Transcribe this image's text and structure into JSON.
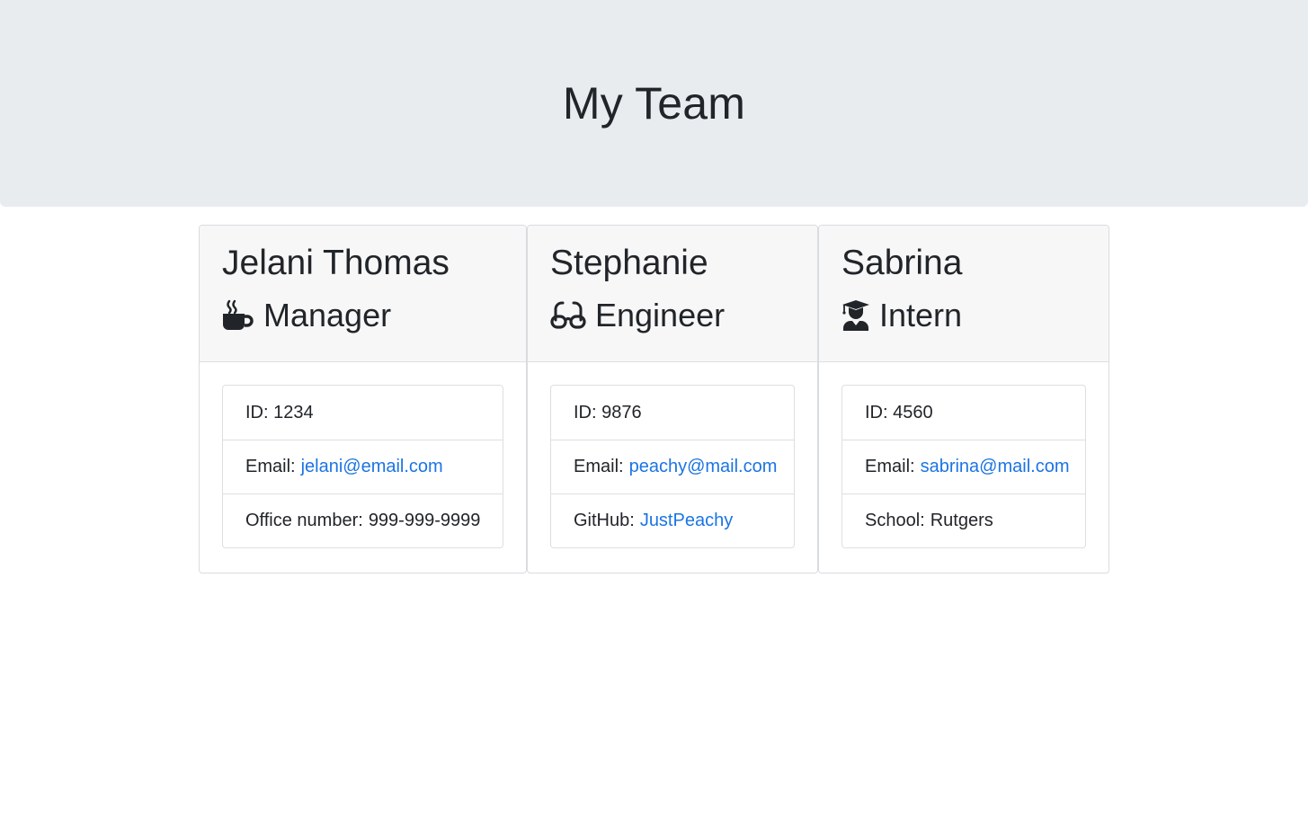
{
  "header": {
    "title": "My Team"
  },
  "team": [
    {
      "name": "Jelani Thomas",
      "role": "Manager",
      "role_icon": "coffee-mug-icon",
      "id_text": "ID: 1234",
      "email_label": "Email:",
      "email": "jelani@email.com",
      "extra_label": "Office number:",
      "extra_value": "999-999-9999"
    },
    {
      "name": "Stephanie",
      "role": "Engineer",
      "role_icon": "glasses-icon",
      "id_text": "ID: 9876",
      "email_label": "Email:",
      "email": "peachy@mail.com",
      "extra_label": "GitHub:",
      "extra_value": "JustPeachy"
    },
    {
      "name": "Sabrina",
      "role": "Intern",
      "role_icon": "graduate-icon",
      "id_text": "ID: 4560",
      "email_label": "Email:",
      "email": "sabrina@mail.com",
      "extra_label": "School:",
      "extra_value": "Rutgers"
    }
  ],
  "colors": {
    "link": "#1b74e4",
    "jumbotron_bg": "#e9ecef",
    "card_header_bg": "#f7f7f7",
    "text": "#212529"
  }
}
